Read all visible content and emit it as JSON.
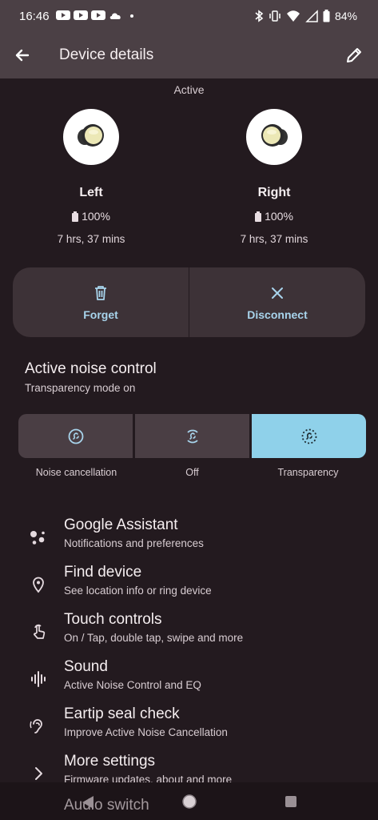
{
  "status": {
    "time": "16:46",
    "battery": "84%",
    "left_icons": [
      "youtube-icon",
      "youtube-icon",
      "youtube-icon",
      "cloud-icon",
      "dot-icon"
    ],
    "right_icons": [
      "bluetooth-icon",
      "vibrate-icon",
      "wifi-icon",
      "signal-icon",
      "battery-icon"
    ]
  },
  "app_bar": {
    "title": "Device details"
  },
  "device": {
    "state": "Active",
    "left": {
      "name": "Left",
      "battery": "100%",
      "time": "7 hrs, 37 mins"
    },
    "right": {
      "name": "Right",
      "battery": "100%",
      "time": "7 hrs, 37 mins"
    }
  },
  "actions": {
    "forget": "Forget",
    "disconnect": "Disconnect"
  },
  "anc": {
    "title": "Active noise control",
    "subtitle": "Transparency mode on",
    "options": [
      "Noise cancellation",
      "Off",
      "Transparency"
    ],
    "selected": "Transparency"
  },
  "settings": [
    {
      "title": "Google Assistant",
      "sub": "Notifications and preferences",
      "icon": "assistant-icon"
    },
    {
      "title": "Find device",
      "sub": "See location info or ring device",
      "icon": "location-pin-icon"
    },
    {
      "title": "Touch controls",
      "sub": "On / Tap, double tap, swipe and more",
      "icon": "touch-icon"
    },
    {
      "title": "Sound",
      "sub": "Active Noise Control and EQ",
      "icon": "sound-wave-icon"
    },
    {
      "title": "Eartip seal check",
      "sub": "Improve Active Noise Cancellation",
      "icon": "ear-icon"
    },
    {
      "title": "More settings",
      "sub": "Firmware updates, about and more",
      "icon": "chevron-right-icon"
    }
  ],
  "peek_item": "Audio switch",
  "colors": {
    "accent": "#8fd1ea",
    "action_text": "#a8d4ec",
    "bar": "#4b4045",
    "bg": "#231a1f"
  }
}
